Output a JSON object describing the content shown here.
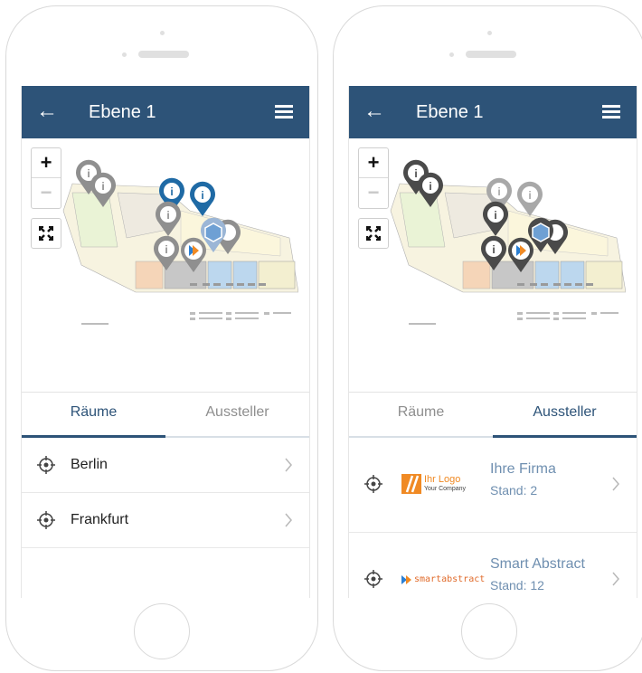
{
  "screens": [
    {
      "title": "Ebene 1",
      "tabs": [
        "Räume",
        "Aussteller"
      ],
      "active_tab": "Räume",
      "rooms": [
        {
          "label": "Berlin"
        },
        {
          "label": "Frankfurt"
        }
      ]
    },
    {
      "title": "Ebene 1",
      "tabs": [
        "Räume",
        "Aussteller"
      ],
      "active_tab": "Aussteller",
      "exhibitors": [
        {
          "name": "Ihre Firma",
          "stand": "Stand: 2",
          "logo": "Ihr Logo",
          "logo_sub": "Your Company"
        },
        {
          "name": "Smart Abstract",
          "stand": "Stand: 12",
          "logo": "smartabstract"
        }
      ]
    }
  ],
  "map": {
    "zoom_in": "+",
    "zoom_out": "−",
    "floor_label": "Main floor plan"
  },
  "colors": {
    "header": "#2d5378",
    "accent": "#2d5378",
    "link_text": "#6f8fb0",
    "pin_gray": "#8f8f8f",
    "pin_dark": "#4a4a4a",
    "pin_blue": "#1f6aa5"
  }
}
